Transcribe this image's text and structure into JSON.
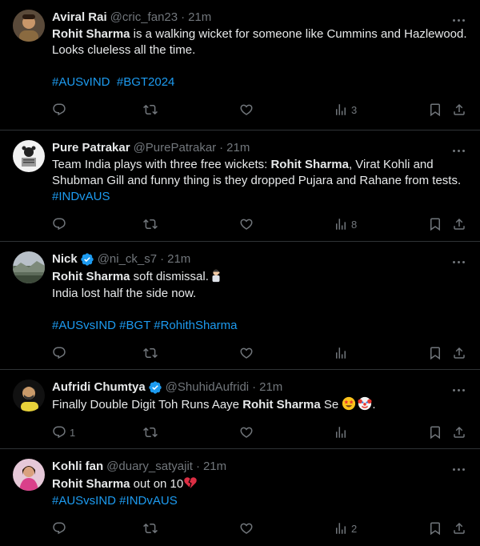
{
  "tweets": [
    {
      "name": "Aviral Rai",
      "handle": "@cric_fan23",
      "time": "21m",
      "verified": false,
      "text_bold": "Rohit Sharma",
      "text_rest": " is a walking wicket for someone like Cummins and Hazlewood. Looks clueless all the time.",
      "hashtags": "#AUSvIND  #BGT2024",
      "replies": "",
      "retweets": "",
      "likes": "",
      "views": "3"
    },
    {
      "name": "Pure Patrakar",
      "handle": "@PurePatrakar",
      "time": "21m",
      "verified": false,
      "text_pre": "Team India plays with three free wickets: ",
      "text_bold": "Rohit Sharma",
      "text_rest": ", Virat Kohli and Shubman Gill and funny thing is they dropped Pujara and Rahane from tests. ",
      "hashtags": "#INDvAUS",
      "replies": "",
      "retweets": "",
      "likes": "",
      "views": "8"
    },
    {
      "name": "Nick",
      "handle": "@ni_ck_s7",
      "time": "21m",
      "verified": true,
      "text_bold": "Rohit Sharma",
      "text_rest": " soft dismissal.",
      "text_line2": "India lost half the side now.",
      "hashtags": "#AUSvsIND #BGT #RohithSharma",
      "replies": "",
      "retweets": "",
      "likes": "",
      "views": ""
    },
    {
      "name": "Aufridi Chumtya",
      "handle": "@ShuhidAufridi",
      "time": "21m",
      "verified": true,
      "text_pre": "Finally Double Digit Toh Runs Aaye ",
      "text_bold": "Rohit Sharma",
      "text_rest": " Se ",
      "text_end": ".",
      "replies": "1",
      "retweets": "",
      "likes": "",
      "views": ""
    },
    {
      "name": "Kohli fan",
      "handle": "@duary_satyajit",
      "time": "21m",
      "verified": false,
      "text_bold": "Rohit Sharma",
      "text_rest": " out on 10",
      "hashtags": "#AUSvsIND #INDvAUS",
      "replies": "",
      "retweets": "",
      "likes": "",
      "views": "2"
    }
  ],
  "colors": {
    "background": "#000000",
    "text": "#e7e9ea",
    "muted": "#71767b",
    "link": "#1d9bf0",
    "divider": "#2f3336",
    "verified": "#1d9bf0"
  },
  "icons": {
    "reply": "reply-icon",
    "retweet": "retweet-icon",
    "like": "heart-icon",
    "views": "views-icon",
    "bookmark": "bookmark-icon",
    "share": "share-icon",
    "more": "more-icon"
  }
}
